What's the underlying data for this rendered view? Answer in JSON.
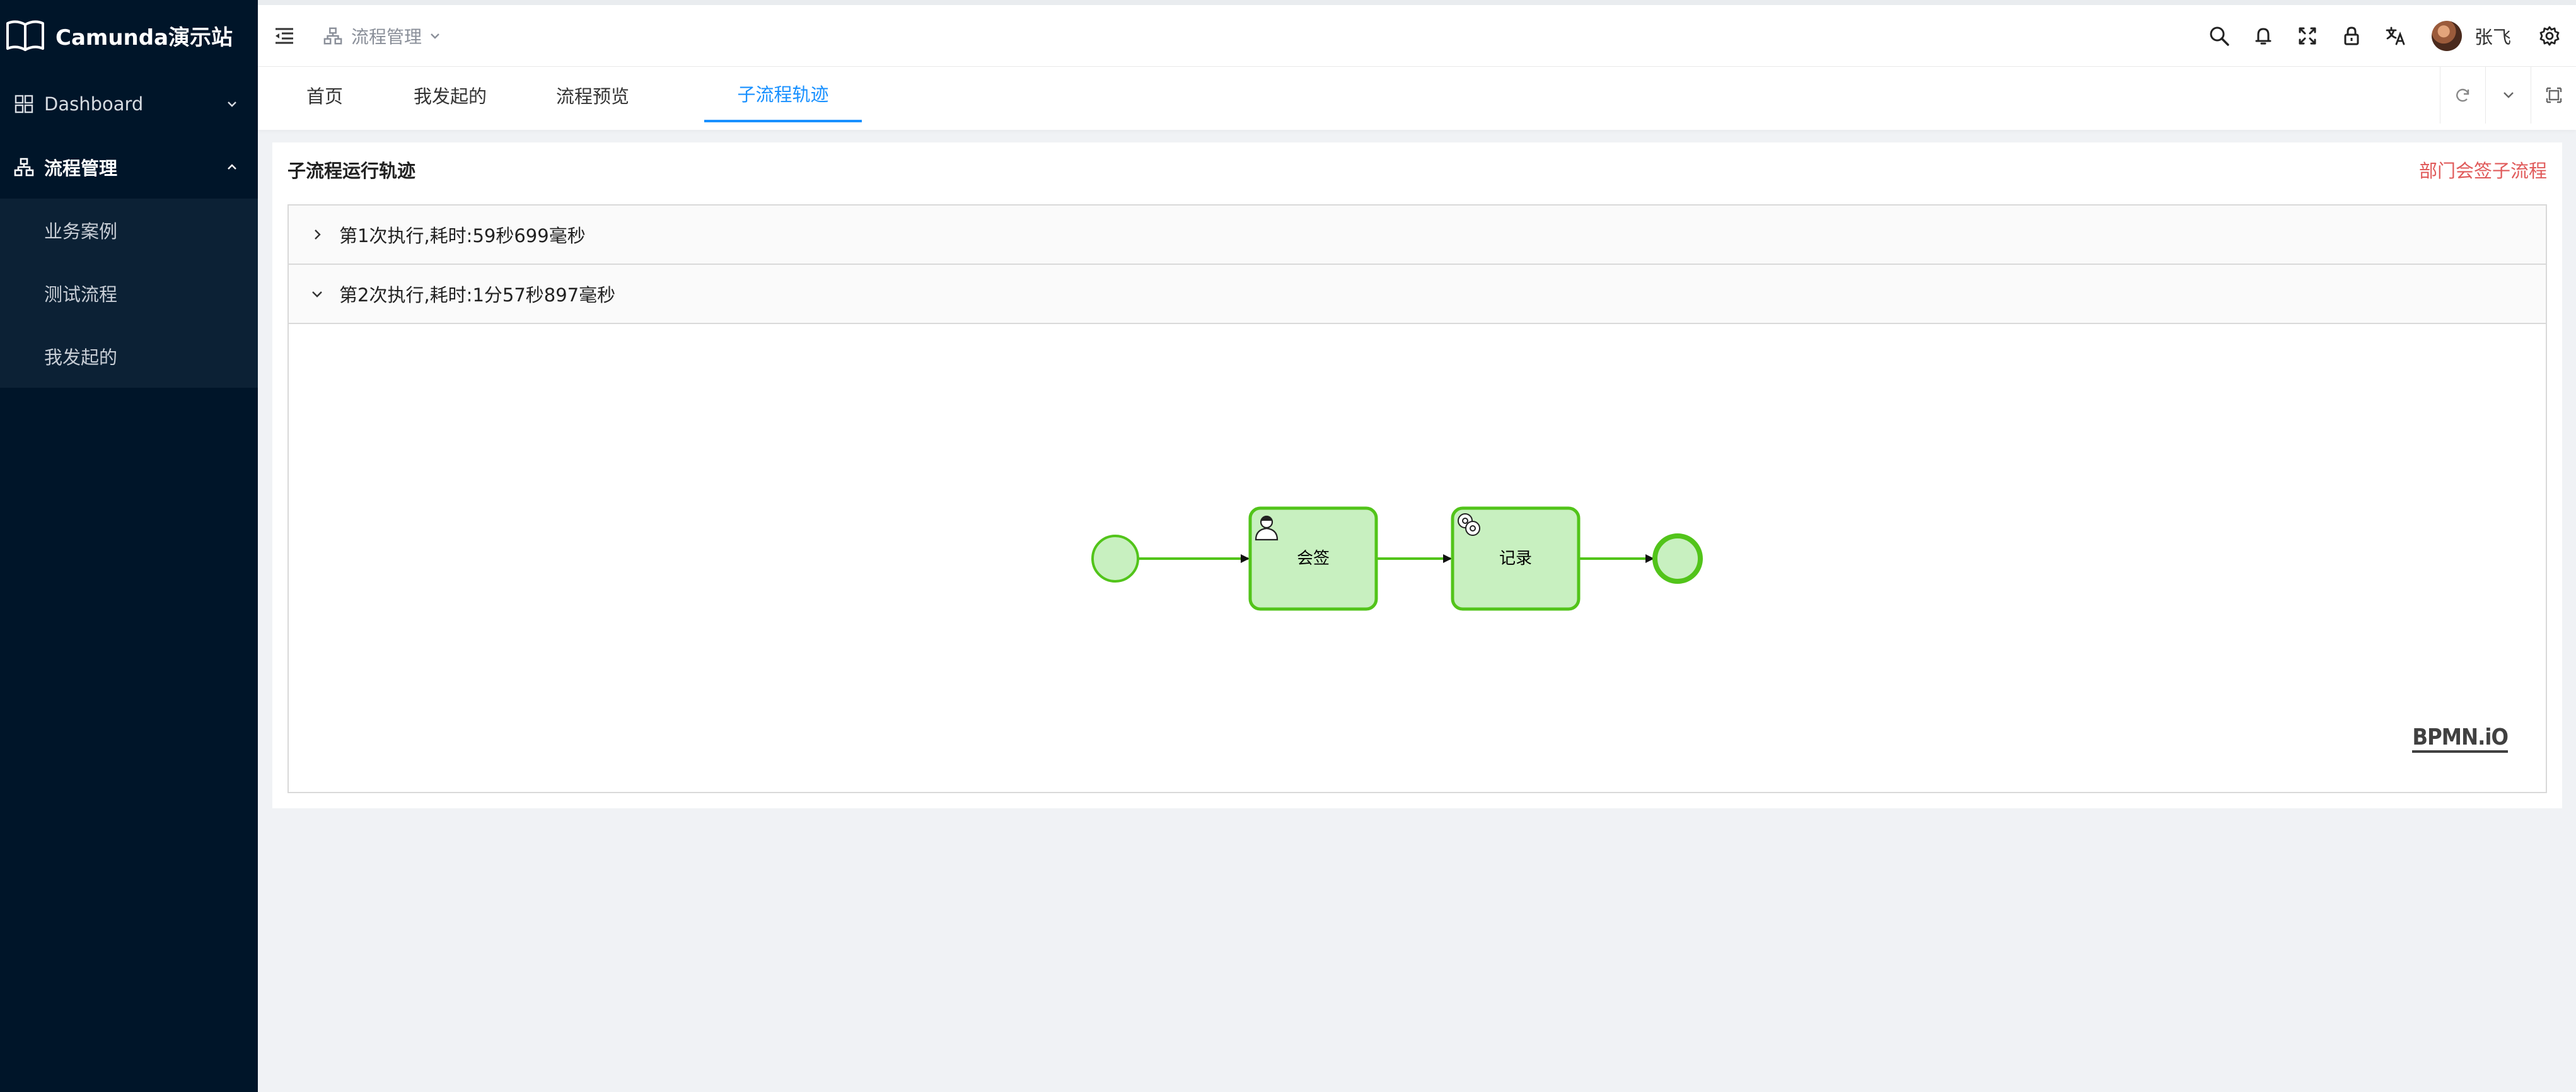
{
  "app": {
    "title": "Camunda演示站"
  },
  "sidebar": {
    "items": [
      {
        "label": "Dashboard",
        "icon": "dashboard-icon",
        "expanded": false
      },
      {
        "label": "流程管理",
        "icon": "flow-icon",
        "expanded": true,
        "children": [
          {
            "label": "业务案例"
          },
          {
            "label": "测试流程"
          },
          {
            "label": "我发起的"
          }
        ]
      }
    ]
  },
  "header": {
    "breadcrumb": "流程管理",
    "username": "张飞",
    "icons": [
      "menu-fold-icon",
      "search-icon",
      "bell-icon",
      "fullscreen-icon",
      "lock-icon",
      "translate-icon",
      "avatar",
      "settings-icon"
    ]
  },
  "tabs": {
    "items": [
      {
        "label": "首页"
      },
      {
        "label": "我发起的"
      },
      {
        "label": "流程预览"
      },
      {
        "label": "子流程轨迹",
        "active": true
      }
    ]
  },
  "card": {
    "title": "子流程运行轨迹",
    "extra": "部门会签子流程",
    "panels": [
      {
        "label": "第1次执行,耗时:59秒699毫秒",
        "expanded": false
      },
      {
        "label": "第2次执行,耗时:1分57秒897毫秒",
        "expanded": true
      }
    ]
  },
  "diagram": {
    "nodes": [
      {
        "type": "start-event"
      },
      {
        "type": "user-task",
        "label": "会签"
      },
      {
        "type": "service-task",
        "label": "记录"
      },
      {
        "type": "end-event"
      }
    ],
    "watermark": "BPMN.iO",
    "colors": {
      "fill": "#c8f0c0",
      "stroke": "#52c41a"
    }
  },
  "colors": {
    "sidebar": "#001529",
    "accent": "#1890ff",
    "extra_link": "#e05a5a"
  }
}
